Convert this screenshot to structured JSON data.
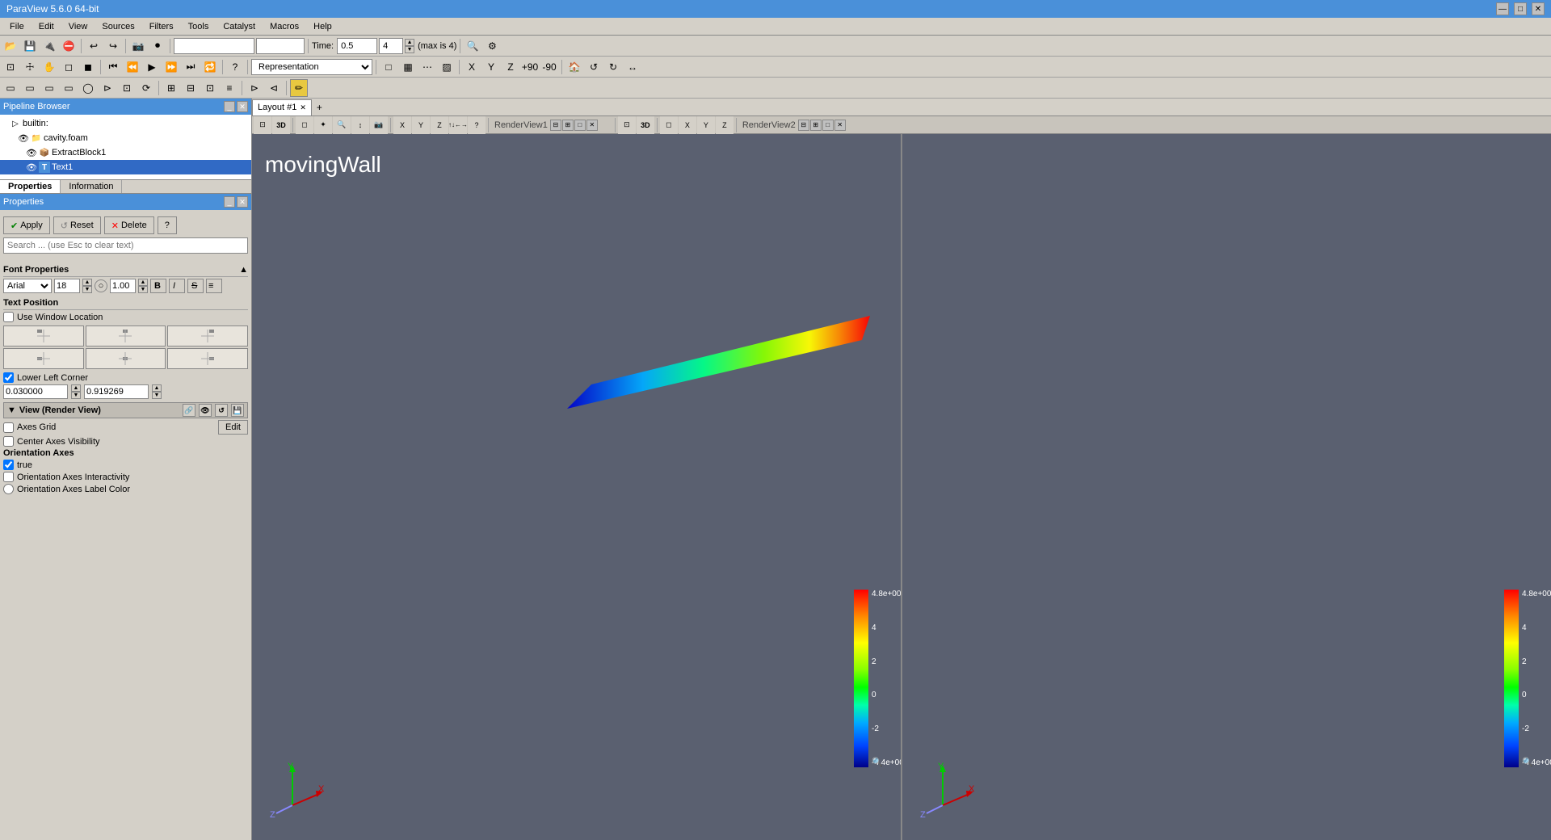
{
  "app": {
    "title": "ParaView 5.6.0 64-bit",
    "titlebar_controls": [
      "—",
      "□",
      "✕"
    ]
  },
  "menu": {
    "items": [
      "File",
      "Edit",
      "View",
      "Sources",
      "Filters",
      "Tools",
      "Catalyst",
      "Macros",
      "Help"
    ]
  },
  "toolbar1": {
    "time_label": "Time:",
    "time_value": "0.5",
    "time_input": "4",
    "time_max_label": "(max is 4)"
  },
  "toolbar2": {
    "representation_label": "Representation",
    "representation_value": "Representation"
  },
  "pipeline": {
    "title": "Pipeline Browser",
    "items": [
      {
        "label": "builtin:",
        "level": 0,
        "icon": "🏠",
        "has_eye": false
      },
      {
        "label": "cavity.foam",
        "level": 1,
        "icon": "📁",
        "has_eye": true,
        "visible": true
      },
      {
        "label": "ExtractBlock1",
        "level": 2,
        "icon": "📦",
        "has_eye": true,
        "visible": true
      },
      {
        "label": "Text1",
        "level": 2,
        "icon": "T",
        "has_eye": true,
        "visible": true,
        "selected": true
      }
    ]
  },
  "properties": {
    "tabs": [
      "Properties",
      "Information"
    ],
    "title": "Properties",
    "actions": {
      "apply_label": "Apply",
      "reset_label": "Reset",
      "delete_label": "Delete",
      "help_label": "?"
    },
    "search_placeholder": "Search ... (use Esc to clear text)",
    "sections": {
      "font_properties": {
        "title": "Font Properties",
        "font_family": "Arial",
        "font_size": "18",
        "bold_label": "B",
        "italic_label": "I",
        "strike_label": "S"
      },
      "text_position": {
        "title": "Text Position",
        "use_window_location": false,
        "lower_left_corner": true,
        "corner_x": "0.030000",
        "corner_y": "0.919269"
      },
      "view": {
        "title": "View (Render View)",
        "axes_grid_label": "Axes Grid",
        "axes_grid_edit": "Edit",
        "center_axes_label": "Center Axes Visibility",
        "center_axes_value": false,
        "orientation_axes_label": "Orientation Axes",
        "orientation_axes_visibility": true,
        "orientation_axes_interactivity": false
      }
    }
  },
  "viewport": {
    "tabs": [
      "Layout #1"
    ],
    "views": [
      {
        "id": "view1",
        "name": "RenderView1",
        "label": "movingWall",
        "colorbar_values": [
          "4.8e+00",
          "4",
          "2",
          "0",
          "-2",
          "-4.4e+00"
        ]
      },
      {
        "id": "view2",
        "name": "RenderView2",
        "label": "",
        "colorbar_values": [
          "4.8e+00",
          "4",
          "2",
          "0",
          "-2",
          "-4.4e+00"
        ]
      }
    ]
  },
  "status_bar": {
    "text": ""
  }
}
